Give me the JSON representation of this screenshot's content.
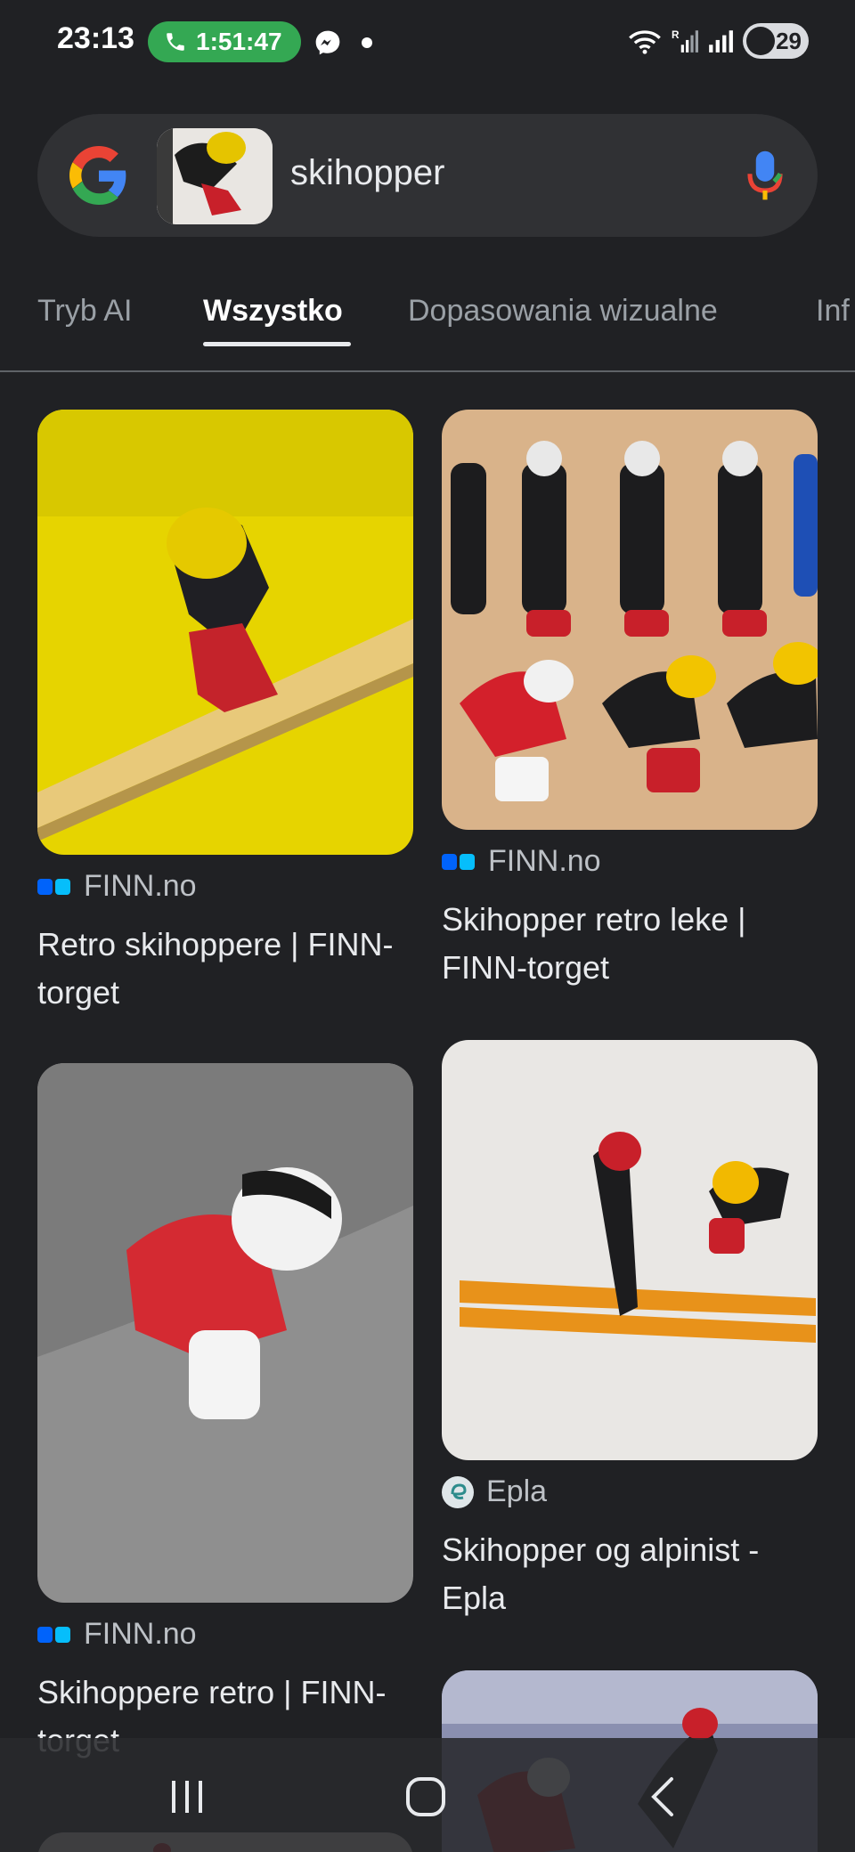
{
  "status_bar": {
    "time": "23:13",
    "call_timer": "1:51:47",
    "battery": "29",
    "call_pill_color": "#34a853"
  },
  "search": {
    "query": "skihopper",
    "logo_icon": "google-g-icon",
    "mic_icon": "microphone-icon"
  },
  "tabs": [
    {
      "label": "Tryb AI",
      "active": false
    },
    {
      "label": "Wszystko",
      "active": true
    },
    {
      "label": "Dopasowania wizualne",
      "active": false
    },
    {
      "label": "Inf",
      "active": false
    }
  ],
  "results": [
    {
      "source": "FINN.no",
      "title": "Retro skihoppere | FINN-torget",
      "source_icon": "finn-icon"
    },
    {
      "source": "FINN.no",
      "title": "Skihopper retro leke | FINN-torget",
      "source_icon": "finn-icon"
    },
    {
      "source": "FINN.no",
      "title": "Skihoppere retro | FINN-torget",
      "source_icon": "finn-icon"
    },
    {
      "source": "Epla",
      "title": "Skihopper og alpinist - Epla",
      "source_icon": "epla-icon"
    }
  ],
  "nav": {
    "recent_icon": "recent-apps-icon",
    "home_icon": "home-icon",
    "back_icon": "back-icon"
  }
}
